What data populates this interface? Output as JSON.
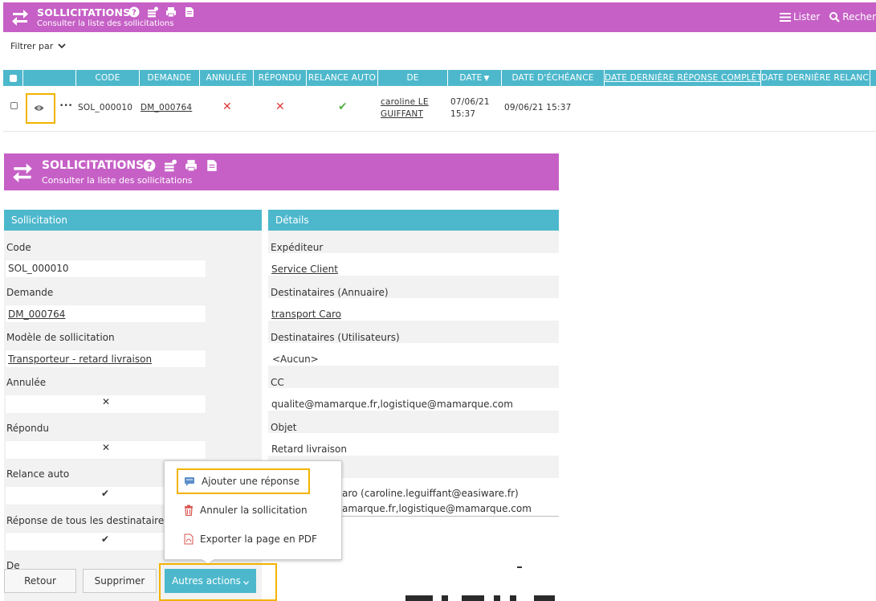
{
  "top_banner": {
    "title": "SOLLICITATIONS",
    "subtitle": "Consulter la liste des sollicitations",
    "lister_label": "Lister",
    "search_label": "Recher"
  },
  "filter": {
    "label": "Filtrer par"
  },
  "table": {
    "columns": [
      "CODE",
      "DEMANDE",
      "ANNULÉE",
      "RÉPONDU",
      "RELANCE AUTO",
      "DE",
      "DATE",
      "DATE D'ÉCHÉANCE",
      "DATE DERNIÈRE RÉPONSE COMPLÈTE",
      "DATE DERNIÈRE RELANCE"
    ],
    "rows": [
      {
        "more": "•••",
        "code": "SOL_000010",
        "demande": "DM_000764",
        "annulee": "✕",
        "repondu": "✕",
        "relance_auto": "✔",
        "de_line1": "caroline LE",
        "de_line2": "GUIFFANT",
        "date_line1": "07/06/21",
        "date_line2": "15:37",
        "echeance": "09/06/21 15:37"
      }
    ]
  },
  "detail_banner": {
    "title": "SOLLICITATIONS",
    "subtitle": "Consulter la liste des sollicitations"
  },
  "sollicitation_panel": {
    "header": "Sollicitation",
    "code_label": "Code",
    "code_value": "SOL_000010",
    "demande_label": "Demande",
    "demande_value": "DM_000764",
    "modele_label": "Modèle de sollicitation",
    "modele_value": "Transporteur - retard livraison",
    "annulee_label": "Annulée",
    "annulee_value": "✕",
    "repondu_label": "Répondu",
    "repondu_value": "✕",
    "relance_label": "Relance auto",
    "relance_value": "✔",
    "reponse_tous_label": "Réponse de tous les destinataires",
    "reponse_tous_value": "✔",
    "de_label": "De"
  },
  "details_panel": {
    "header": "Détails",
    "expediteur_label": "Expéditeur",
    "expediteur_value": "Service Client",
    "dest_annuaire_label": "Destinataires (Annuaire)",
    "dest_annuaire_value": "transport Caro",
    "dest_utilisateurs_label": "Destinataires (Utilisateurs)",
    "dest_utilisateurs_value": "<Aucun>",
    "cc_label": "CC",
    "cc_value": "qualite@mamarque.fr,logistique@mamarque.com",
    "objet_label": "Objet",
    "objet_value": "Retard livraison",
    "partial_line1": "aro (caroline.leguiffant@easiware.fr)",
    "partial_line2": "amarque.fr,logistique@mamarque.com"
  },
  "popup_menu": {
    "items": [
      "Ajouter une réponse",
      "Annuler la sollicitation",
      "Exporter la page en PDF"
    ]
  },
  "footer": {
    "back_label": "Retour",
    "delete_label": "Supprimer",
    "other_actions_label": "Autres actions"
  },
  "colors": {
    "banner": "#c660c6",
    "header_teal": "#4db8cc",
    "highlight": "#f3b300",
    "cross_red": "#e03a3a",
    "check_green": "#5ab14a"
  }
}
